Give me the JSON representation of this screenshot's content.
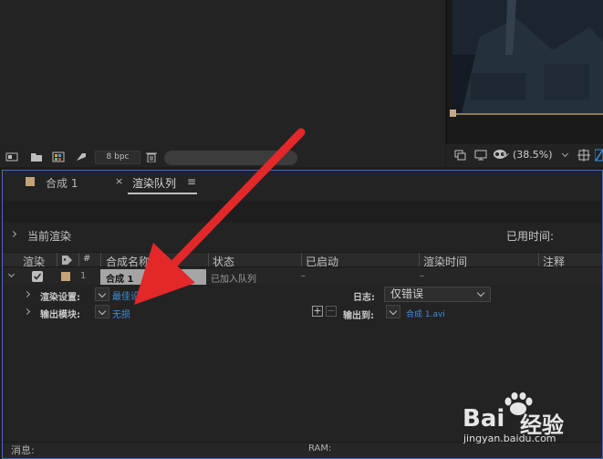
{
  "project": {
    "bpc_label": "8 bpc"
  },
  "viewer": {
    "zoom_label": "(38.5%)"
  },
  "render_queue": {
    "tabs": [
      {
        "label": "合成 1"
      },
      {
        "label": "渲染队列"
      }
    ],
    "tab_close": "×",
    "tab_menu": "≡",
    "current_render_label": "当前渲染",
    "elapsed_label": "已用时间:",
    "columns": [
      "渲染",
      "#",
      "合成名称",
      "状态",
      "已启动",
      "渲染时间",
      "注释"
    ],
    "row": {
      "number": "1",
      "comp_name": "合成 1",
      "status": "已加入队列",
      "started": "–",
      "render_time": "–"
    },
    "render_settings_label": "渲染设置:",
    "render_settings_value": "最佳设置",
    "output_module_label": "输出模块:",
    "output_module_value": "无损",
    "log_label": "日志:",
    "log_value": "仅错误",
    "output_to_label": "输出到:",
    "output_to_value": "合成 1.avi"
  },
  "status_bar": {
    "messages_label": "消息:",
    "ram_label": "RAM:"
  },
  "watermark": {
    "brand": "Bai",
    "brand_suffix": "经验",
    "url": "jingyan.baidu.com"
  },
  "colors": {
    "accent": "#3e8fdc",
    "panel_border": "#3f6fb5",
    "swatch": "#c3a27a",
    "arrow": "#e3282a"
  }
}
